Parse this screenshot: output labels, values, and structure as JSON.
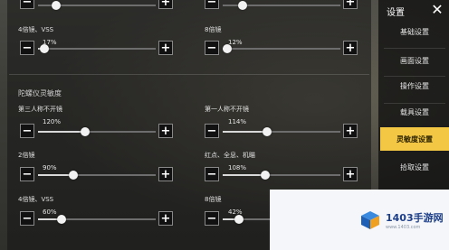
{
  "sidebar": {
    "title": "设置",
    "items": [
      {
        "label": "基础设置"
      },
      {
        "label": "画面设置"
      },
      {
        "label": "操作设置"
      },
      {
        "label": "载具设置"
      },
      {
        "label": "灵敏度设置",
        "active": true
      },
      {
        "label": "拾取设置"
      }
    ]
  },
  "top_rows": [
    {
      "label": "",
      "value": "",
      "percent": null
    },
    {
      "label": "",
      "value": "",
      "percent": null
    }
  ],
  "camera_section": {
    "rows": [
      {
        "label": "4倍镜、VSS",
        "value": "17%",
        "percent": 17
      },
      {
        "label": "8倍镜",
        "value": "12%",
        "percent": 12
      }
    ]
  },
  "gyro_section": {
    "title": "陀螺仪灵敏度",
    "rows": [
      {
        "label": "第三人称不开镜",
        "value": "120%",
        "percent": 120
      },
      {
        "label": "第一人称不开镜",
        "value": "114%",
        "percent": 114
      },
      {
        "label": "2倍镜",
        "value": "90%",
        "percent": 90
      },
      {
        "label": "红点、全息、机瞄",
        "value": "108%",
        "percent": 108
      },
      {
        "label": "4倍镜、VSS",
        "value": "60%",
        "percent": 60
      },
      {
        "label": "8倍镜",
        "value": "42%",
        "percent": 42
      }
    ]
  },
  "slider_max": 300,
  "buttons": {
    "minus": "−",
    "plus": "+"
  },
  "close_glyph": "✕",
  "watermark": {
    "name": "1403手游网",
    "url": "www.1403.com"
  }
}
